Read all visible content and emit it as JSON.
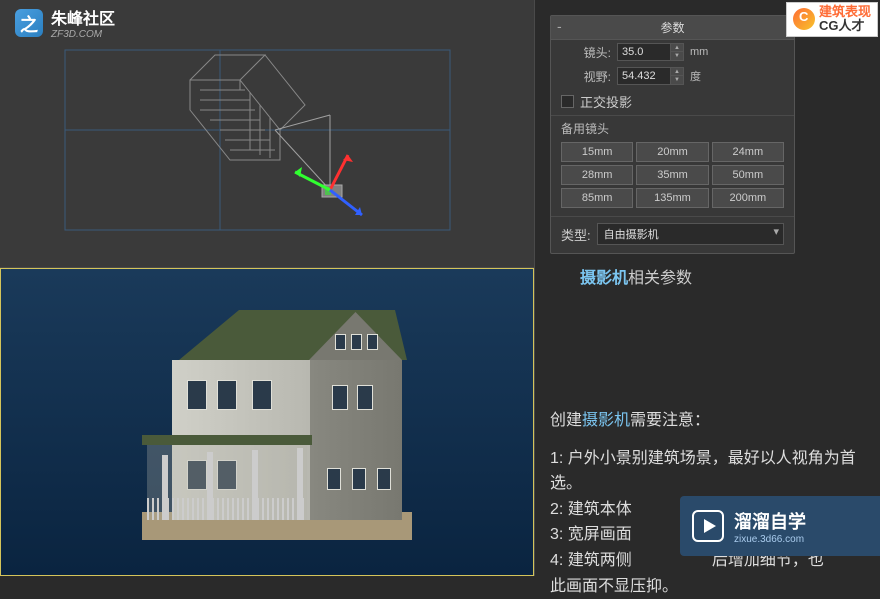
{
  "logo": {
    "title": "朱峰社区",
    "subtitle": "ZF3D.COM"
  },
  "badge_top": {
    "line1": "建筑表现",
    "line2": "CG人才"
  },
  "badge_bottom": {
    "title": "溜溜自学",
    "sub": "zixue.3d66.com"
  },
  "panel": {
    "title": "参数",
    "lens_label": "镜头:",
    "lens_value": "35.0",
    "lens_unit": "mm",
    "fov_label": "视野:",
    "fov_value": "54.432",
    "fov_unit": "度",
    "ortho_label": "正交投影",
    "presets_label": "备用镜头",
    "presets": [
      "15mm",
      "20mm",
      "24mm",
      "28mm",
      "35mm",
      "50mm",
      "85mm",
      "135mm",
      "200mm"
    ],
    "type_label": "类型:",
    "type_value": "自由摄影机"
  },
  "help": {
    "prefix": "",
    "highlight": "摄影机",
    "suffix": "相关参数"
  },
  "notes": {
    "title_prefix": "创建",
    "title_highlight": "摄影机",
    "title_suffix": "需要注意：",
    "line1": "1: 户外小景别建筑场景，最好以人视角为首选。",
    "line2": "2: 建筑本体",
    "line3": "3: 宽屏画面",
    "line4a": "4: 建筑两侧",
    "line4b": "后增加细节，也",
    "line4c": "此画面不显压抑。"
  }
}
